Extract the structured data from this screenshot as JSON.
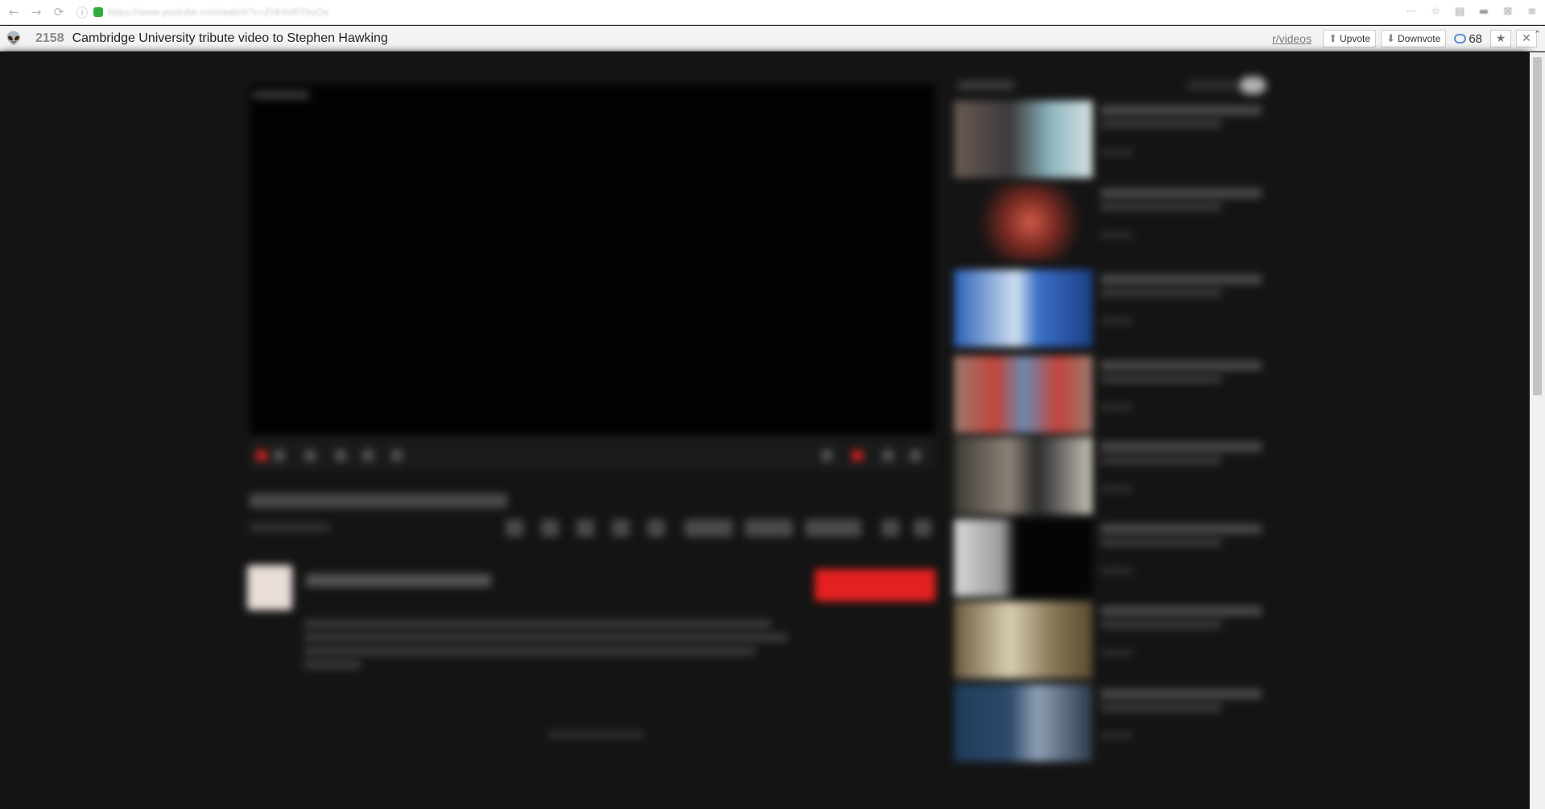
{
  "browser": {
    "url": "https://www.youtube.com/watch?v=ZHHtvRTbsOs",
    "nav": {
      "back": "←",
      "forward": "→",
      "reload": "⟳",
      "info": "ⓘ"
    },
    "toolbar_icons": [
      "⋯",
      "☆",
      "▤",
      "▬",
      "⊠",
      "≡"
    ]
  },
  "reddit_toolbar": {
    "alien_icon": "👽",
    "score": "2158",
    "title": "Cambridge University tribute video to Stephen Hawking",
    "subreddit": "r/videos",
    "upvote_label": "Upvote",
    "downvote_label": "Downvote",
    "comment_count": "68",
    "save_icon": "★",
    "close_icon": "✕",
    "scroll_up": "⌃"
  }
}
